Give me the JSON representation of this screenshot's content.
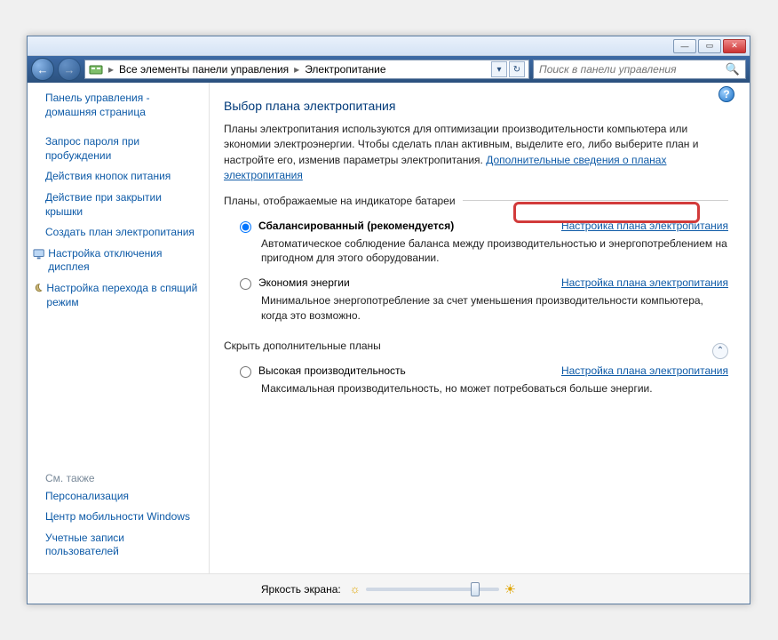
{
  "titlebar": {
    "min": "—",
    "max": "▭",
    "close": "✕"
  },
  "nav": {
    "back": "←",
    "fwd": "→"
  },
  "breadcrumb": {
    "root": "Все элементы панели управления",
    "current": "Электропитание",
    "sep1": "▸",
    "sep2": "▸",
    "dd": "▾",
    "refresh": "↻"
  },
  "search": {
    "placeholder": "Поиск в панели управления",
    "icon": "🔍"
  },
  "help": {
    "q": "?"
  },
  "sidebar": {
    "home": "Панель управления - домашняя страница",
    "links": [
      "Запрос пароля при пробуждении",
      "Действия кнопок питания",
      "Действие при закрытии крышки",
      "Создать план электропитания"
    ],
    "icon_links": [
      "Настройка отключения дисплея",
      "Настройка перехода в спящий режим"
    ],
    "seealso_hdr": "См. также",
    "seealso": [
      "Персонализация",
      "Центр мобильности Windows",
      "Учетные записи пользователей"
    ]
  },
  "main": {
    "title": "Выбор плана электропитания",
    "intro_text": "Планы электропитания используются для оптимизации производительности компьютера или экономии электроэнергии. Чтобы сделать план активным, выделите его, либо выберите план и настройте его, изменив параметры электропитания. ",
    "intro_link": "Дополнительные сведения о планах электропитания",
    "legend1": "Планы, отображаемые на индикаторе батареи",
    "legend2": "Скрыть дополнительные планы",
    "collapse_icon": "⌃",
    "configure_link": "Настройка плана электропитания",
    "plans_primary": [
      {
        "title": "Сбалансированный (рекомендуется)",
        "checked": true,
        "desc": "Автоматическое соблюдение баланса между производительностью и энергопотреблением на пригодном для этого оборудовании."
      },
      {
        "title": "Экономия энергии",
        "checked": false,
        "desc": "Минимальное энергопотребление за счет уменьшения производительности компьютера, когда это возможно."
      }
    ],
    "plans_extra": [
      {
        "title": "Высокая производительность",
        "checked": false,
        "desc": "Максимальная производительность, но может потребоваться больше энергии."
      }
    ]
  },
  "brightness": {
    "label": "Яркость экрана:"
  }
}
